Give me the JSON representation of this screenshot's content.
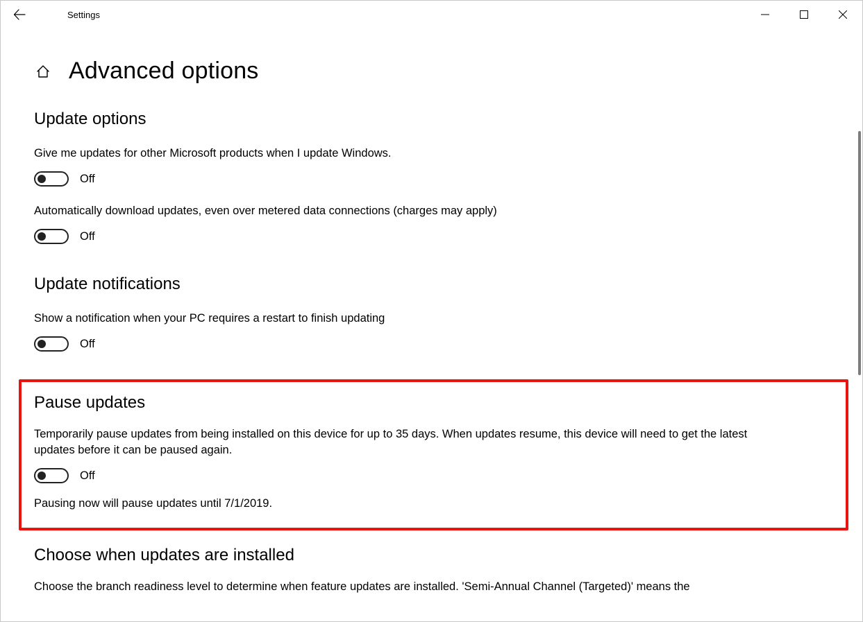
{
  "titlebar": {
    "app_title": "Settings"
  },
  "page": {
    "title": "Advanced options"
  },
  "sections": {
    "update_options": {
      "heading": "Update options",
      "item1": {
        "label": "Give me updates for other Microsoft products when I update Windows.",
        "state": "Off"
      },
      "item2": {
        "label": "Automatically download updates, even over metered data connections (charges may apply)",
        "state": "Off"
      }
    },
    "update_notifications": {
      "heading": "Update notifications",
      "item1": {
        "label": "Show a notification when your PC requires a restart to finish updating",
        "state": "Off"
      }
    },
    "pause_updates": {
      "heading": "Pause updates",
      "description": "Temporarily pause updates from being installed on this device for up to 35 days. When updates resume, this device will need to get the latest updates before it can be paused again.",
      "state": "Off",
      "note": "Pausing now will pause updates until 7/1/2019."
    },
    "choose_when": {
      "heading": "Choose when updates are installed",
      "description": "Choose the branch readiness level to determine when feature updates are installed. 'Semi-Annual Channel (Targeted)' means the"
    }
  }
}
